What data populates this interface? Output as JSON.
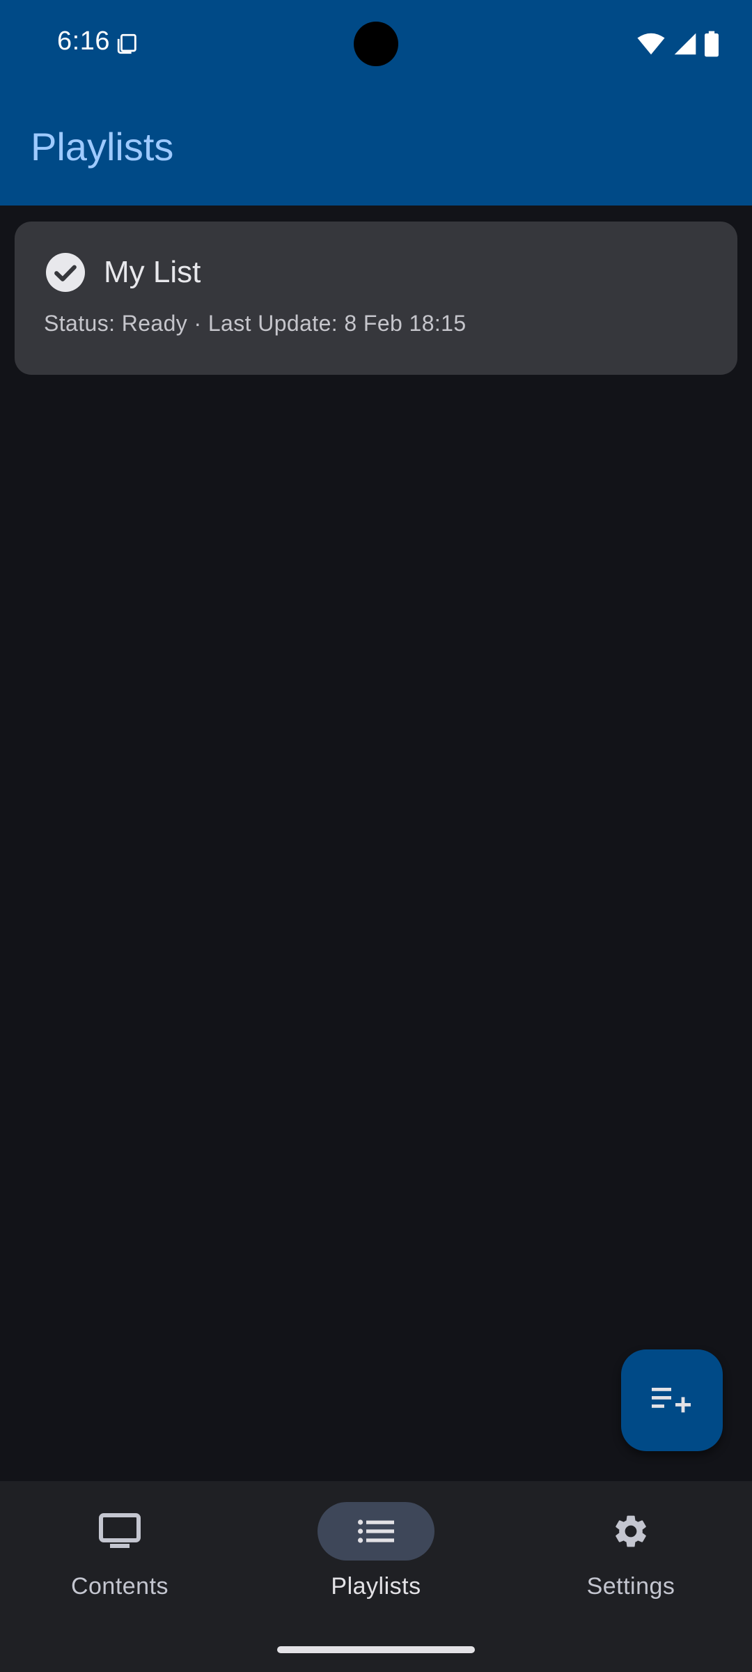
{
  "status_bar": {
    "time": "6:16",
    "icons": [
      "copy-icon",
      "wifi-icon",
      "signal-icon",
      "battery-icon"
    ]
  },
  "app_bar": {
    "title": "Playlists",
    "background": "#004a87",
    "title_color": "#9ecaff"
  },
  "playlists": [
    {
      "name": "My List",
      "status_line": "Status: Ready · Last Update: 8 Feb 18:15",
      "icon": "check-circle-icon"
    }
  ],
  "fab": {
    "icon": "playlist-add-icon"
  },
  "bottom_nav": {
    "items": [
      {
        "label": "Contents",
        "icon": "tv-icon",
        "active": false
      },
      {
        "label": "Playlists",
        "icon": "list-icon",
        "active": true
      },
      {
        "label": "Settings",
        "icon": "gear-icon",
        "active": false
      }
    ]
  }
}
